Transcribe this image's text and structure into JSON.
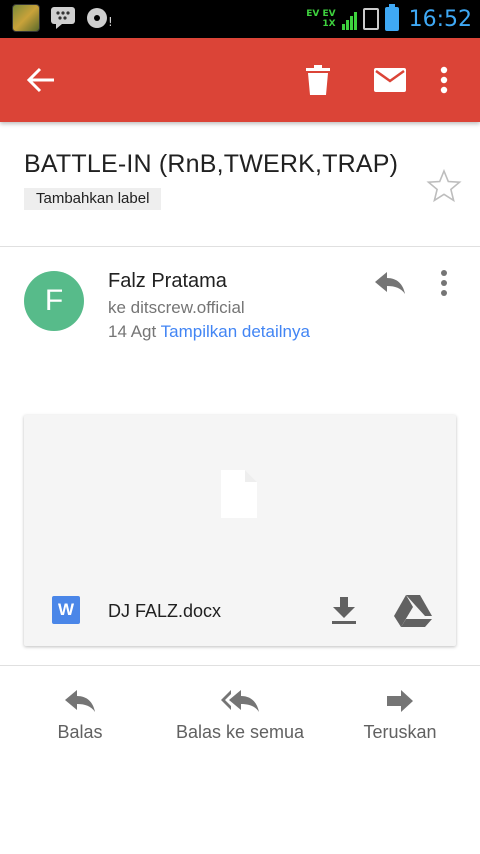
{
  "status_bar": {
    "network_top": "EV EV",
    "network_bottom": "1X",
    "time": "16:52",
    "time_color": "#3fa9f5",
    "signal_color": "#3ed13e"
  },
  "toolbar": {
    "color": "#db4437",
    "icons": [
      "back-arrow-icon",
      "delete-icon",
      "mark-unread-icon",
      "more-vert-icon"
    ]
  },
  "email": {
    "subject": "BATTLE-IN (RnB,TWERK,TRAP)",
    "add_label": "Tambahkan label",
    "sender_initial": "F",
    "sender_name": "Falz Pratama",
    "recipient": "ke ditscrew.official",
    "date": "14 Agt",
    "details_link": "Tampilkan detailnya",
    "avatar_color": "#57bb8a",
    "link_color": "#4285f4"
  },
  "attachment": {
    "type_letter": "W",
    "file_name": "DJ FALZ.docx",
    "type_color": "#4a86e8"
  },
  "actions": {
    "reply": "Balas",
    "reply_all": "Balas ke semua",
    "forward": "Teruskan"
  }
}
